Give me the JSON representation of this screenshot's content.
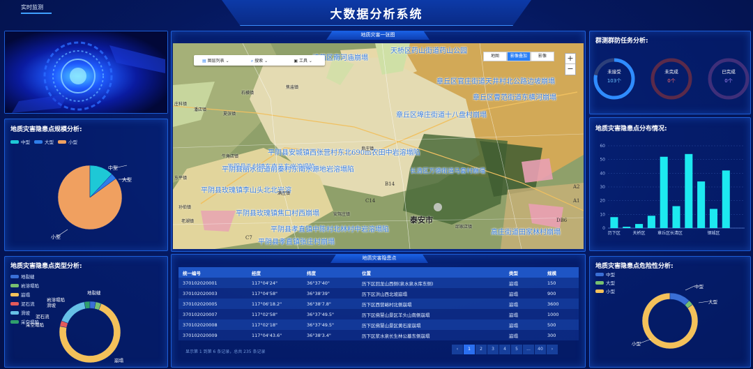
{
  "header": {
    "title": "大数据分析系统",
    "tab": "实时监测"
  },
  "scale_panel": {
    "title": "地质灾害隐患点规模分析:",
    "legend": [
      {
        "label": "中型",
        "color": "#1ec8d6"
      },
      {
        "label": "大型",
        "color": "#2f7de8"
      },
      {
        "label": "小型",
        "color": "#f0a060"
      }
    ],
    "labels": [
      "中型",
      "大型",
      "小型"
    ]
  },
  "type_panel": {
    "title": "地质灾害隐患点类型分析:",
    "legend": [
      {
        "label": "地裂缝",
        "color": "#3a6fd6"
      },
      {
        "label": "岩溶塌陷",
        "color": "#77c070"
      },
      {
        "label": "崩塌",
        "color": "#f4c15a"
      },
      {
        "label": "泥石流",
        "color": "#e35a5a"
      },
      {
        "label": "滑坡",
        "color": "#66c0e6"
      },
      {
        "label": "采空塌陷",
        "color": "#2f9f6c"
      }
    ],
    "labels": [
      "岩溶塌陷",
      "地裂缝",
      "采空塌陷",
      "泥石流",
      "滑坡",
      "崩塌"
    ]
  },
  "map_panel": {
    "title": "地质灾害一张图",
    "toolbar": [
      "图层列表",
      "搜索",
      "工具"
    ],
    "map_types": [
      "地图",
      "影像叠加",
      "影像"
    ],
    "zoom_in": "+",
    "zoom_out": "−",
    "places": [
      "泰安市",
      "邱家店镇",
      "焦庙镇",
      "潘店镇",
      "牛角店镇",
      "良庄镇",
      "东平镇",
      "孙伯镇",
      "安驾庄镇",
      "满庄镇",
      "夏张镇",
      "石横镇",
      "庄科镇",
      "老湖镇"
    ],
    "labels": [
      "天桥区药山街道药山公园",
      "槐荫区南河庙崩塌",
      "章丘区官庄街道天井村北公路边坡崩塌",
      "章丘区曹范街道东横河崩塌",
      "章丘区埠庄街道十八盘村崩塌",
      "平阴县安城镇西张营村东北690m农田中岩溶塌陷",
      "平阴县孔村镇东南马东岩溶塌陷",
      "平阴县丽水街道前秦村东南水源地岩溶塌陷",
      "长清区万德街道马套村崩塌",
      "平阴县玫瑰镇李山头北北岩溶",
      "平阴县玫瑰镇焦口村西崩塌",
      "平阴县孝直镇中陈村北林村中岩溶塌陷",
      "高庄街道田家林村崩塌",
      "平阴县孝直镇张庄村崩塌"
    ],
    "codes": [
      "A2",
      "A1",
      "B14",
      "C7",
      "C14",
      "DB6"
    ]
  },
  "task_panel": {
    "title": "群测群防任务分析:",
    "rings": [
      {
        "label": "未接受",
        "value": "103个",
        "color": "#2f8cff",
        "progress": 0.78
      },
      {
        "label": "未完成",
        "value": "0个",
        "color": "#e85b6c",
        "progress": 0.0
      },
      {
        "label": "已完成",
        "value": "0个",
        "color": "#8c5cf0",
        "progress": 0.0
      }
    ]
  },
  "distribution_panel": {
    "title": "地质灾害隐患点分布情况:"
  },
  "danger_panel": {
    "title": "地质灾害隐患点危险性分析:",
    "legend": [
      {
        "label": "中型",
        "color": "#3a6fd6"
      },
      {
        "label": "大型",
        "color": "#77c070"
      },
      {
        "label": "小型",
        "color": "#f4c15a"
      }
    ],
    "labels": [
      "中型",
      "大型",
      "小型"
    ]
  },
  "table_panel": {
    "title": "地质灾害隐患点",
    "columns": [
      "统一编号",
      "经度",
      "纬度",
      "位置",
      "类型",
      "规模"
    ],
    "rows": [
      [
        "370102020001",
        "117°04'24\"",
        "36°37'40\"",
        "历下区回龙山西侧(泉水泉水库东侧)",
        "崩塌",
        "150"
      ],
      [
        "370102020003",
        "117°04'58\"",
        "36°38'39\"",
        "历下区洪山西北坡崩塌",
        "崩塌",
        "900"
      ],
      [
        "370102020005",
        "117°06'18.2\"",
        "36°38'7.8\"",
        "历下区西营峪村北侧崩塌",
        "崩塌",
        "3600"
      ],
      [
        "370102020007",
        "117°02'58\"",
        "36°37'49.5\"",
        "历下区佛慧山景区羊头山南侧崩塌",
        "崩塌",
        "1000"
      ],
      [
        "370102020008",
        "117°02'18\"",
        "36°37'49.5\"",
        "历下区佛慧山景区黄石崖崩塌",
        "崩塌",
        "500"
      ],
      [
        "370102020009",
        "117°04'43.6\"",
        "36°38'3.4\"",
        "历下区浆水泉长生林公墓东侧崩塌",
        "崩塌",
        "300"
      ]
    ],
    "footer": "显示第 1 到第 6 条记录，总共 235 条记录",
    "pages": [
      "‹",
      "1",
      "2",
      "3",
      "4",
      "5",
      "...",
      "40",
      "›"
    ]
  },
  "chart_data": [
    {
      "type": "pie",
      "categories": [
        "中型",
        "大型",
        "小型"
      ],
      "values": [
        12,
        3,
        85
      ],
      "colors": [
        "#1ec8d6",
        "#2f7de8",
        "#f0a060"
      ]
    },
    {
      "type": "pie",
      "donut": true,
      "categories": [
        "地裂缝",
        "岩溶塌陷",
        "崩塌",
        "泥石流",
        "滑坡",
        "采空塌陷"
      ],
      "values": [
        3,
        3,
        72,
        3,
        16,
        3
      ],
      "colors": [
        "#3a6fd6",
        "#77c070",
        "#f4c15a",
        "#e35a5a",
        "#66c0e6",
        "#2f9f6c"
      ]
    },
    {
      "type": "bar",
      "categories": [
        "历下区",
        "市中区",
        "天桥区",
        "历城区",
        "章丘区",
        "长清区",
        "平阴县",
        "济阳区",
        "钢城区",
        "莱芜区",
        "商河县"
      ],
      "values": [
        8,
        1,
        3,
        9,
        52,
        16,
        54,
        34,
        14,
        42,
        0
      ],
      "tick_labels": [
        "历下区",
        "天桥区",
        "章丘区",
        "长清区",
        "钢城区"
      ],
      "yticks": [
        0,
        10,
        20,
        30,
        40,
        50,
        60
      ],
      "ylim": [
        0,
        60
      ],
      "color": "#1de9f0"
    },
    {
      "type": "pie",
      "donut": true,
      "categories": [
        "中型",
        "大型",
        "小型"
      ],
      "values": [
        12,
        3,
        85
      ],
      "colors": [
        "#3a6fd6",
        "#77c070",
        "#f4c15a"
      ]
    }
  ]
}
